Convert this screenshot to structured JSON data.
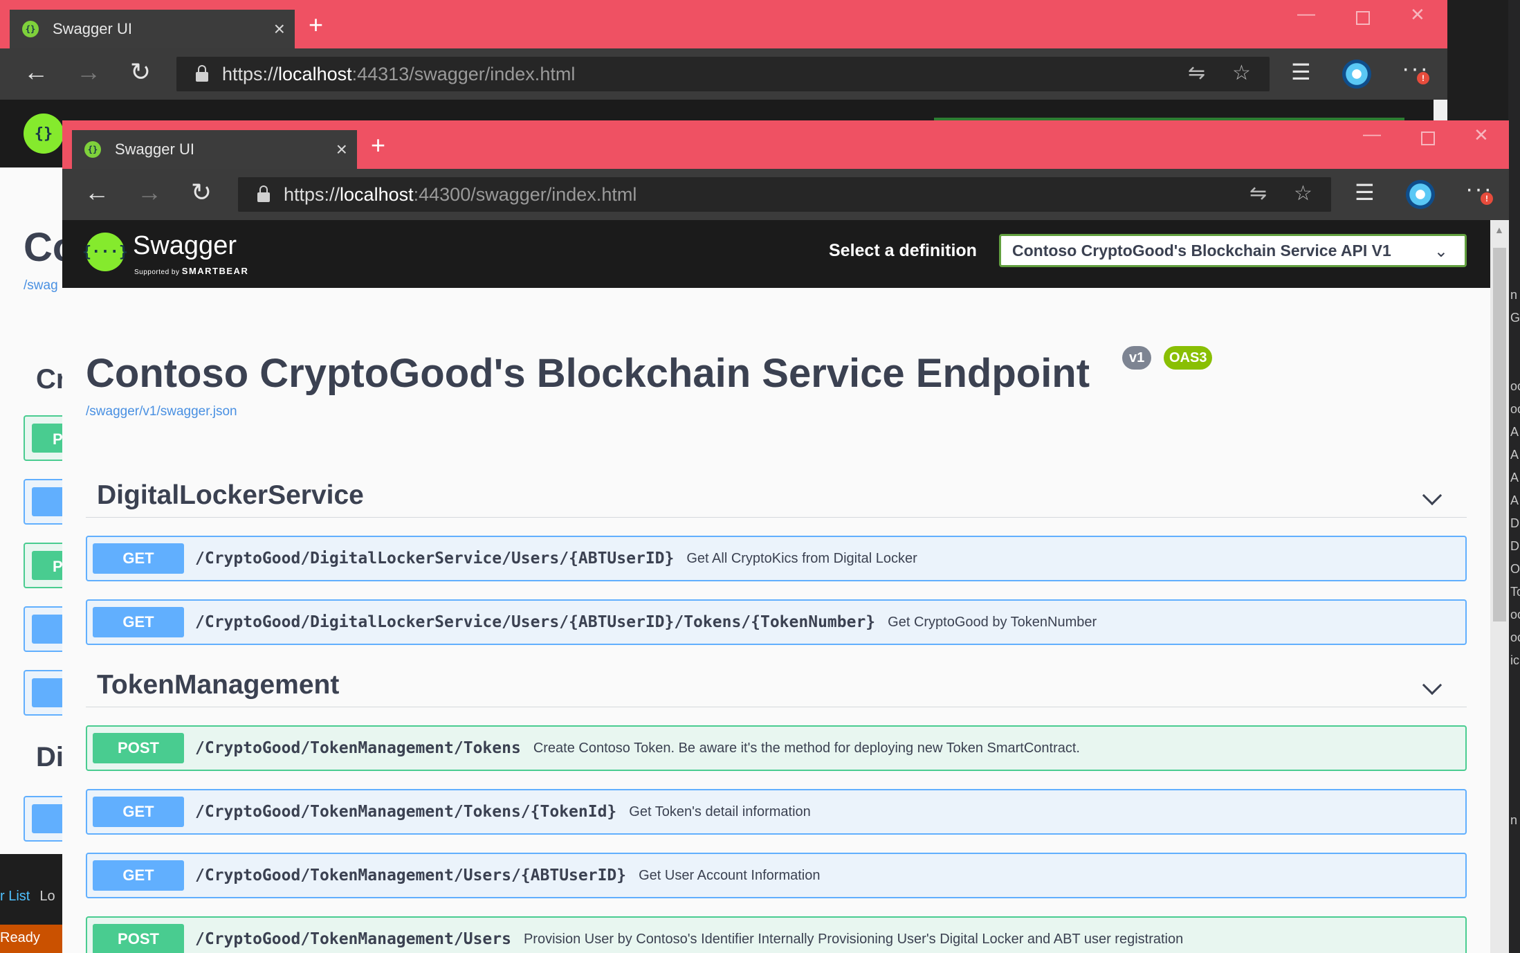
{
  "back_window": {
    "tab_title": "Swagger UI",
    "url_scheme": "https://",
    "url_host": "localhost",
    "url_rest": ":44313/swagger/index.html",
    "visible_title": "Co",
    "visible_link": "/swag",
    "visible_section_1": "Cr",
    "visible_section_2": "Di",
    "visible_op_letters": [
      "P",
      "",
      "P",
      "",
      "",
      ""
    ],
    "ide_tabs": {
      "error_list": "r List",
      "output": "Lo"
    },
    "status": "Ready",
    "ide_chars": [
      "n",
      "G",
      "",
      "",
      "oc",
      "oc",
      "A",
      "A",
      "A",
      "A",
      "D",
      "D",
      "O",
      "To",
      "oc",
      "oc",
      "ic",
      "",
      "",
      "",
      "",
      "",
      "",
      "n"
    ]
  },
  "front_window": {
    "tab_title": "Swagger UI",
    "url_scheme": "https://",
    "url_host": "localhost",
    "url_rest": ":44300/swagger/index.html",
    "icons": {
      "back": "arrow-left-icon",
      "forward": "arrow-right-icon",
      "refresh": "refresh-icon",
      "read_aloud": "translate-icon",
      "favorite": "star-icon",
      "favorites": "favorites-icon",
      "profile": "avatar",
      "more": "more-icon"
    },
    "notification_count": "!"
  },
  "swagger": {
    "logo_text": "{···}",
    "brand": "Swagger",
    "supported_by": "Supported by",
    "smartbear": "SMARTBEAR",
    "definition_label": "Select a definition",
    "definition_selected": "Contoso CryptoGood's Blockchain Service API V1",
    "title": "Contoso CryptoGood's Blockchain Service Endpoint",
    "version": "v1",
    "oas": "OAS3",
    "spec_link": "/swagger/v1/swagger.json",
    "tags": [
      {
        "name": "DigitalLockerService",
        "operations": [
          {
            "method": "GET",
            "path": "/CryptoGood/DigitalLockerService/Users/{ABTUserID}",
            "summary": "Get All CryptoKics from Digital Locker"
          },
          {
            "method": "GET",
            "path": "/CryptoGood/DigitalLockerService/Users/{ABTUserID}/Tokens/{TokenNumber}",
            "summary": "Get CryptoGood by TokenNumber"
          }
        ]
      },
      {
        "name": "TokenManagement",
        "operations": [
          {
            "method": "POST",
            "path": "/CryptoGood/TokenManagement/Tokens",
            "summary": "Create Contoso Token. Be aware it's the method for deploying new Token SmartContract."
          },
          {
            "method": "GET",
            "path": "/CryptoGood/TokenManagement/Tokens/{TokenId}",
            "summary": "Get Token's detail information"
          },
          {
            "method": "GET",
            "path": "/CryptoGood/TokenManagement/Users/{ABTUserID}",
            "summary": "Get User Account Information"
          },
          {
            "method": "POST",
            "path": "/CryptoGood/TokenManagement/Users",
            "summary": "Provision User by Contoso's Identifier Internally Provisioning User's Digital Locker and ABT user registration"
          }
        ]
      }
    ]
  },
  "colors": {
    "tabbar": "#ef5163",
    "swagger_green": "#85ea2d",
    "get": "#61affe",
    "post": "#49cc90",
    "select_border": "#62a03f"
  }
}
